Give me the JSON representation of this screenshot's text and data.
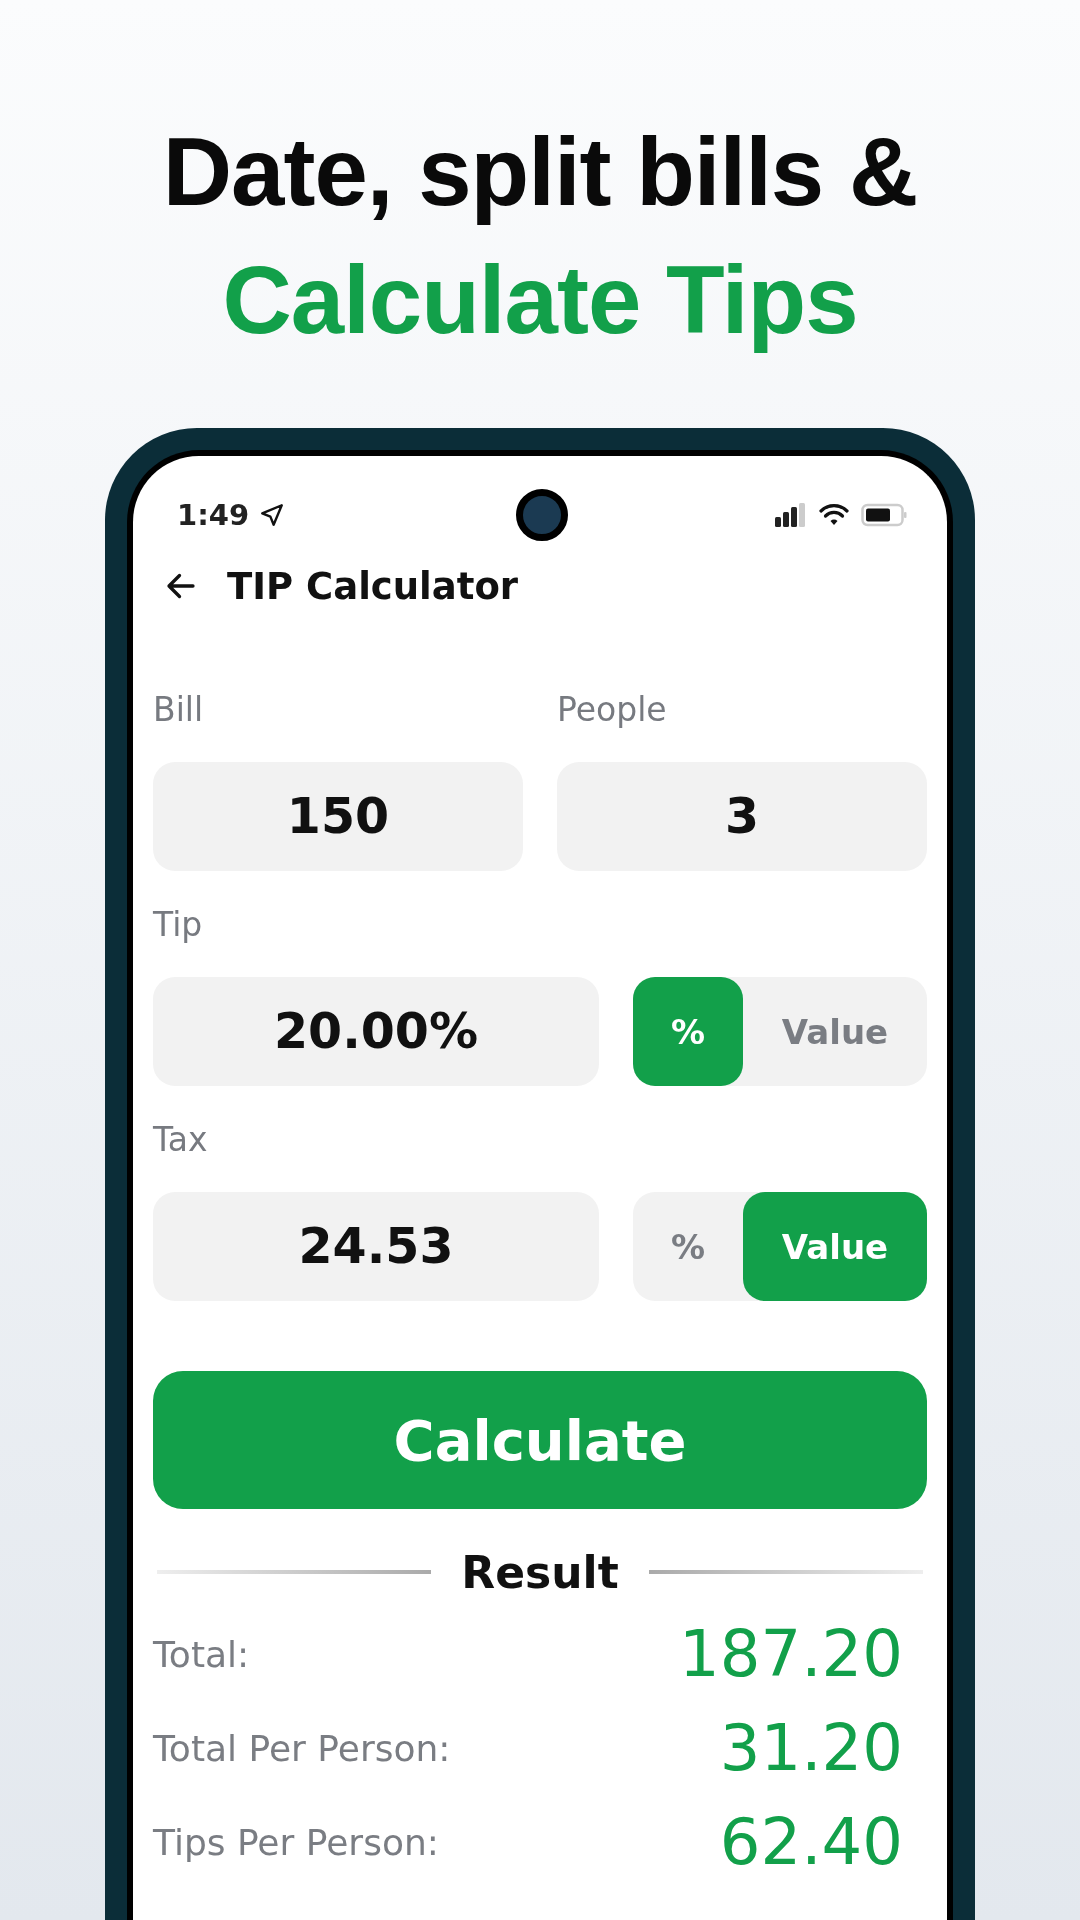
{
  "headline": {
    "line_1": "Date, split bills &",
    "line_2": "Calculate Tips"
  },
  "status_bar": {
    "time": "1:49"
  },
  "app_bar": {
    "title": "TIP Calculator"
  },
  "inputs": [
    {
      "label": "Bill",
      "value": "150"
    },
    {
      "label": "People",
      "value": "3"
    }
  ],
  "modes": [
    {
      "label": "Tip",
      "value": "20.00%",
      "options": [
        {
          "label": "%",
          "selected": true
        },
        {
          "label": "Value",
          "selected": false
        }
      ]
    },
    {
      "label": "Tax",
      "value": "24.53",
      "options": [
        {
          "label": "%",
          "selected": false
        },
        {
          "label": "Value",
          "selected": true
        }
      ]
    }
  ],
  "calculate_button": "Calculate",
  "result": {
    "title": "Result",
    "rows": [
      {
        "label": "Total:",
        "value": "187.20"
      },
      {
        "label": "Total Per Person:",
        "value": "31.20"
      },
      {
        "label": "Tips Per Person:",
        "value": "62.40"
      }
    ]
  }
}
